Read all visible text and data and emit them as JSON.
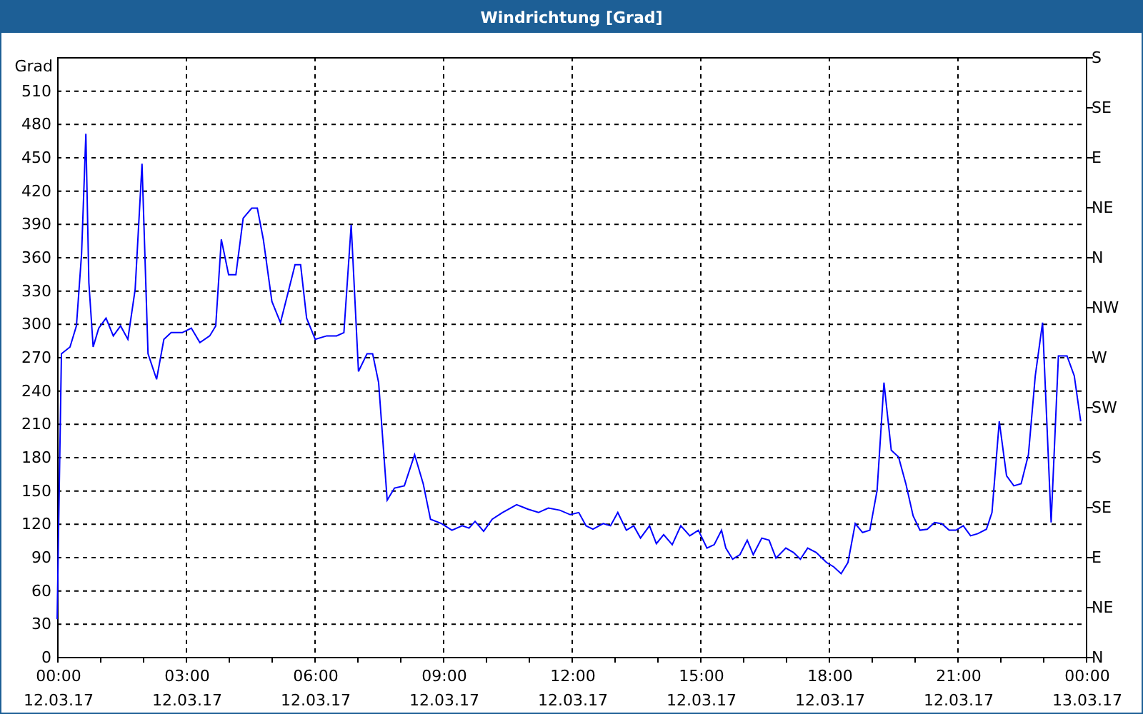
{
  "chart_panel": {
    "chart_data": {
      "type": "line",
      "grid": true,
      "title": "Windrichtung [Grad]",
      "ylabel": "Grad",
      "xlim": [
        0,
        24
      ],
      "ylim": [
        0,
        540
      ],
      "x": [
        0,
        0.1,
        0.3,
        0.45,
        0.57,
        0.67,
        0.74,
        0.84,
        0.97,
        1.14,
        1.31,
        1.48,
        1.65,
        1.82,
        1.98,
        2.12,
        2.32,
        2.49,
        2.66,
        2.92,
        3.13,
        3.33,
        3.56,
        3.7,
        3.83,
        4,
        4.17,
        4.34,
        4.54,
        4.67,
        4.81,
        5.01,
        5.21,
        5.38,
        5.55,
        5.68,
        5.82,
        6.02,
        6.29,
        6.52,
        6.69,
        6.86,
        7.03,
        7.23,
        7.36,
        7.5,
        7.7,
        7.87,
        8.1,
        8.34,
        8.54,
        8.71,
        8.97,
        9.21,
        9.45,
        9.61,
        9.75,
        9.95,
        10.15,
        10.39,
        10.72,
        10.99,
        11.23,
        11.46,
        11.73,
        11.97,
        12.17,
        12.34,
        12.5,
        12.74,
        12.91,
        13.08,
        13.28,
        13.45,
        13.61,
        13.82,
        13.98,
        14.15,
        14.35,
        14.55,
        14.76,
        14.96,
        15.16,
        15.33,
        15.5,
        15.6,
        15.76,
        15.93,
        16.1,
        16.24,
        16.44,
        16.61,
        16.77,
        17,
        17.18,
        17.34,
        17.51,
        17.71,
        17.95,
        18.12,
        18.29,
        18.45,
        18.62,
        18.79,
        18.96,
        19.13,
        19.29,
        19.46,
        19.63,
        19.8,
        19.97,
        20.13,
        20.3,
        20.47,
        20.64,
        20.81,
        20.97,
        21.14,
        21.31,
        21.48,
        21.68,
        21.81,
        21.98,
        22.15,
        22.32,
        22.49,
        22.66,
        22.82,
        22.99,
        23.19,
        23.36,
        23.56,
        23.73,
        23.88
      ],
      "series": [
        {
          "color": "#0000ff",
          "values": [
            34,
            273,
            279,
            298,
            363,
            471,
            337,
            279,
            296,
            305,
            289,
            298,
            286,
            331,
            444,
            273,
            250,
            286,
            292,
            292,
            296,
            283,
            289,
            298,
            376,
            344,
            344,
            395,
            404,
            404,
            376,
            320,
            301,
            327,
            353,
            353,
            305,
            286,
            289,
            289,
            292,
            389,
            257,
            273,
            273,
            247,
            141,
            152,
            154,
            182,
            156,
            124,
            120,
            114,
            118,
            116,
            122,
            113,
            124,
            130,
            137,
            133,
            130,
            134,
            132,
            128,
            130,
            118,
            115,
            120,
            118,
            130,
            114,
            118,
            107,
            118,
            102,
            110,
            101,
            118,
            109,
            114,
            98,
            101,
            114,
            98,
            88,
            92,
            105,
            92,
            107,
            105,
            89,
            98,
            94,
            88,
            98,
            94,
            85,
            81,
            75,
            85,
            120,
            112,
            114,
            150,
            247,
            186,
            180,
            156,
            127,
            114,
            115,
            121,
            120,
            114,
            114,
            118,
            109,
            111,
            115,
            130,
            212,
            163,
            154,
            156,
            182,
            253,
            301,
            121,
            271,
            271,
            253,
            212
          ]
        }
      ],
      "yticks": [
        0,
        30,
        60,
        90,
        120,
        150,
        180,
        210,
        240,
        270,
        300,
        330,
        360,
        390,
        420,
        450,
        480,
        510
      ],
      "xticks": [
        {
          "value": 0,
          "label": "00:00"
        },
        {
          "value": 3,
          "label": "03:00"
        },
        {
          "value": 6,
          "label": "06:00"
        },
        {
          "value": 9,
          "label": "09:00"
        },
        {
          "value": 12,
          "label": "12:00"
        },
        {
          "value": 15,
          "label": "15:00"
        },
        {
          "value": 18,
          "label": "18:00"
        },
        {
          "value": 21,
          "label": "21:00"
        },
        {
          "value": 24,
          "label": "00:00"
        }
      ]
    },
    "x_date_labels": [
      "12.03.17",
      "12.03.17",
      "12.03.17",
      "12.03.17",
      "12.03.17",
      "12.03.17",
      "12.03.17",
      "12.03.17",
      "13.03.17"
    ],
    "compass_labels": [
      "S",
      "SE",
      "E",
      "NE",
      "N",
      "NW",
      "W",
      "SW",
      "S",
      "SE",
      "E",
      "NE",
      "N"
    ]
  }
}
